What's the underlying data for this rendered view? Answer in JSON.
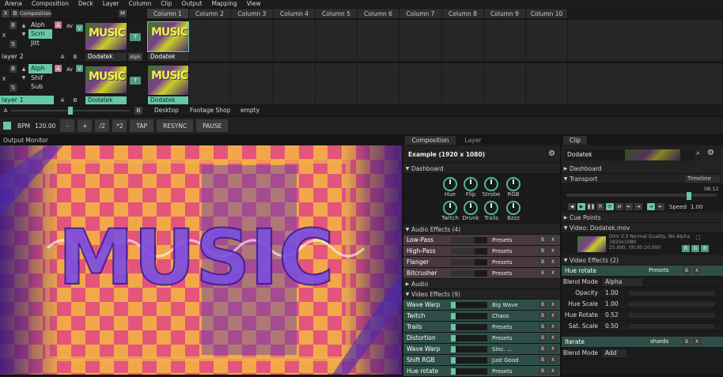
{
  "menu": [
    "Arena",
    "Composition",
    "Deck",
    "Layer",
    "Column",
    "Clip",
    "Output",
    "Mapping",
    "View"
  ],
  "composition_label": "Composition",
  "columns": [
    "Column 1",
    "Column 2",
    "Column 3",
    "Column 4",
    "Column 5",
    "Column 6",
    "Column 7",
    "Column 8",
    "Column 9",
    "Column 10"
  ],
  "layer2": {
    "name": "layer 2",
    "effects": [
      "Alph",
      "Scrn",
      "Jitt"
    ],
    "clip": "Dodatek",
    "mode": "Alph"
  },
  "layer1": {
    "name": "layer 1",
    "effects": [
      "Alph",
      "Shif",
      "Sub"
    ],
    "clip": "Dodatek"
  },
  "buttons": {
    "x": "X",
    "b": "B",
    "s": "S",
    "m": "M",
    "a": "A",
    "av": "AV",
    "v": "V",
    "t": "T"
  },
  "decks": [
    "Desktop",
    "Footage Shop",
    "empty"
  ],
  "transport": {
    "bpm_label": "BPM",
    "bpm": "120.00",
    "minus": "-",
    "plus": "+",
    "div2": "/2",
    "mul2": "*2",
    "tap": "TAP",
    "resync": "RESYNC",
    "pause": "PAUSE"
  },
  "output_monitor": {
    "title": "Output Monitor",
    "text": "MUSIC"
  },
  "comp_panel": {
    "tabs": [
      "Composition",
      "Layer"
    ],
    "title": "Example (1920 x 1080)",
    "dashboard": "Dashboard",
    "knobs": [
      "Hue",
      "Flip",
      "Strobe",
      "RGB",
      "Twitch",
      "Drunk",
      "Trails",
      "Bzzz"
    ],
    "audio_section": "Audio Effects (4)",
    "audio_effects": [
      {
        "name": "Low-Pass",
        "preset": "Presets"
      },
      {
        "name": "High-Pass",
        "preset": "Presets"
      },
      {
        "name": "Flanger",
        "preset": "Presets"
      },
      {
        "name": "Bitcrusher",
        "preset": "Presets"
      }
    ],
    "audio": "Audio",
    "video_section": "Video Effects (9)",
    "video_effects": [
      {
        "name": "Wave Warp",
        "preset": "Big Wave"
      },
      {
        "name": "Twitch",
        "preset": "Chaos"
      },
      {
        "name": "Trails",
        "preset": "Presets"
      },
      {
        "name": "Distortion",
        "preset": "Presets"
      },
      {
        "name": "Wave Warp",
        "preset": "Sinc. ..."
      },
      {
        "name": "Shift RGB",
        "preset": "Just Good"
      },
      {
        "name": "Hue rotate",
        "preset": "Presets"
      }
    ]
  },
  "clip_panel": {
    "tab": "Clip",
    "clip_name": "Dodatek",
    "dashboard": "Dashboard",
    "transport": "Transport",
    "timeline": "Timeline",
    "time": "08.12",
    "speed_label": "Speed",
    "speed": "1.00",
    "cue_points": "Cue Points",
    "video_file": "Video: Dodatek.mov",
    "file_info": [
      "DXV 3.0 Normal Quality, No Alpha",
      "1920x1080",
      "25.895, 00:00:10.000"
    ],
    "rgb": [
      "R",
      "G",
      "B"
    ],
    "video_effects": "Video Effects (2)",
    "hue_rotate": "Hue rotate",
    "presets": "Presets",
    "params": [
      {
        "label": "Blend Mode",
        "value": "Alpha"
      },
      {
        "label": "Opacity",
        "value": "1.00"
      },
      {
        "label": "Hue Scale",
        "value": "1.00"
      },
      {
        "label": "Hue Rotate",
        "value": "0.52"
      },
      {
        "label": "Sat. Scale",
        "value": "0.50"
      }
    ],
    "iterate": "Iterate",
    "shards": "shards",
    "blend_mode2": "Blend Mode",
    "add": "Add"
  }
}
